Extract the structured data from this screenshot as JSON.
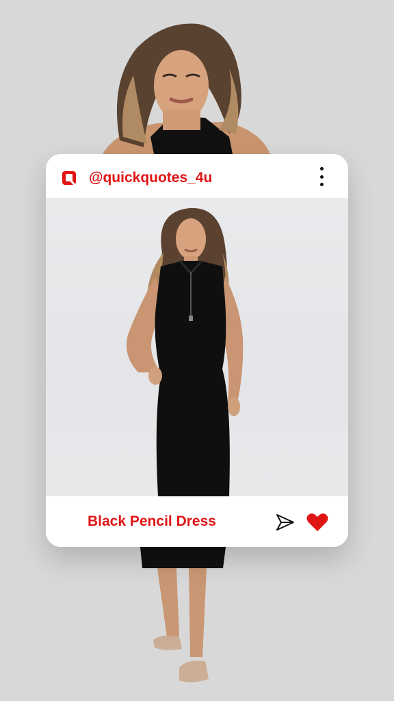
{
  "post": {
    "handle": "@quickquotes_4u",
    "caption": "Black Pencil Dress"
  },
  "icons": {
    "logo": "quickquotes-logo-icon",
    "more": "more-vertical-icon",
    "share": "send-icon",
    "like": "heart-icon"
  },
  "colors": {
    "accent": "#e11414",
    "background": "#d8d8d8",
    "card": "#ffffff"
  }
}
